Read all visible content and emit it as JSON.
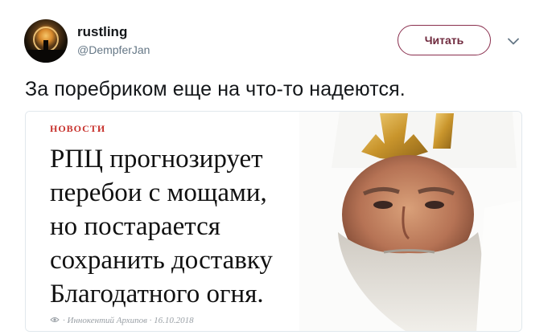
{
  "user": {
    "display_name": "rustling",
    "handle": "@DempferJan"
  },
  "follow_button": {
    "label": "Читать"
  },
  "tweet": {
    "text": "За поребриком еще на что-то надеются."
  },
  "card": {
    "kicker": "НОВОСТИ",
    "headline_lines": [
      "РПЦ прогнозирует",
      "перебои с мощами,",
      "но постарается",
      "сохранить доставку",
      "Благодатного огня."
    ],
    "byline": "· Иннокентий Архипов · 16.10.2018"
  },
  "colors": {
    "kicker": "#c7302b",
    "follow_border": "#8a2f4e",
    "handle": "#657786"
  },
  "icons": {
    "chevron": "chevron-down-icon",
    "eye": "eye-icon"
  }
}
